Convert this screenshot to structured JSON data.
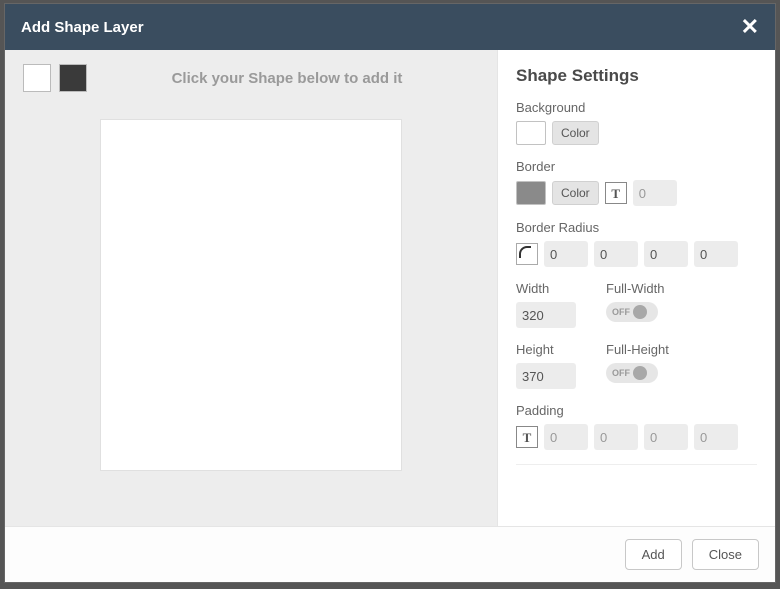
{
  "titlebar": {
    "title": "Add Shape Layer"
  },
  "left": {
    "hint": "Click your Shape below to add it"
  },
  "settings": {
    "title": "Shape Settings",
    "background": {
      "label": "Background",
      "color_btn": "Color"
    },
    "border": {
      "label": "Border",
      "color_btn": "Color",
      "width_placeholder": "0"
    },
    "border_radius": {
      "label": "Border Radius",
      "tl": "0",
      "tr": "0",
      "br": "0",
      "bl": "0"
    },
    "width": {
      "label": "Width",
      "value": "320"
    },
    "height": {
      "label": "Height",
      "value": "370"
    },
    "full_width": {
      "label": "Full-Width",
      "state": "OFF"
    },
    "full_height": {
      "label": "Full-Height",
      "state": "OFF"
    },
    "padding": {
      "label": "Padding",
      "t": "0",
      "r": "0",
      "b": "0",
      "l": "0"
    }
  },
  "footer": {
    "add": "Add",
    "close": "Close"
  }
}
